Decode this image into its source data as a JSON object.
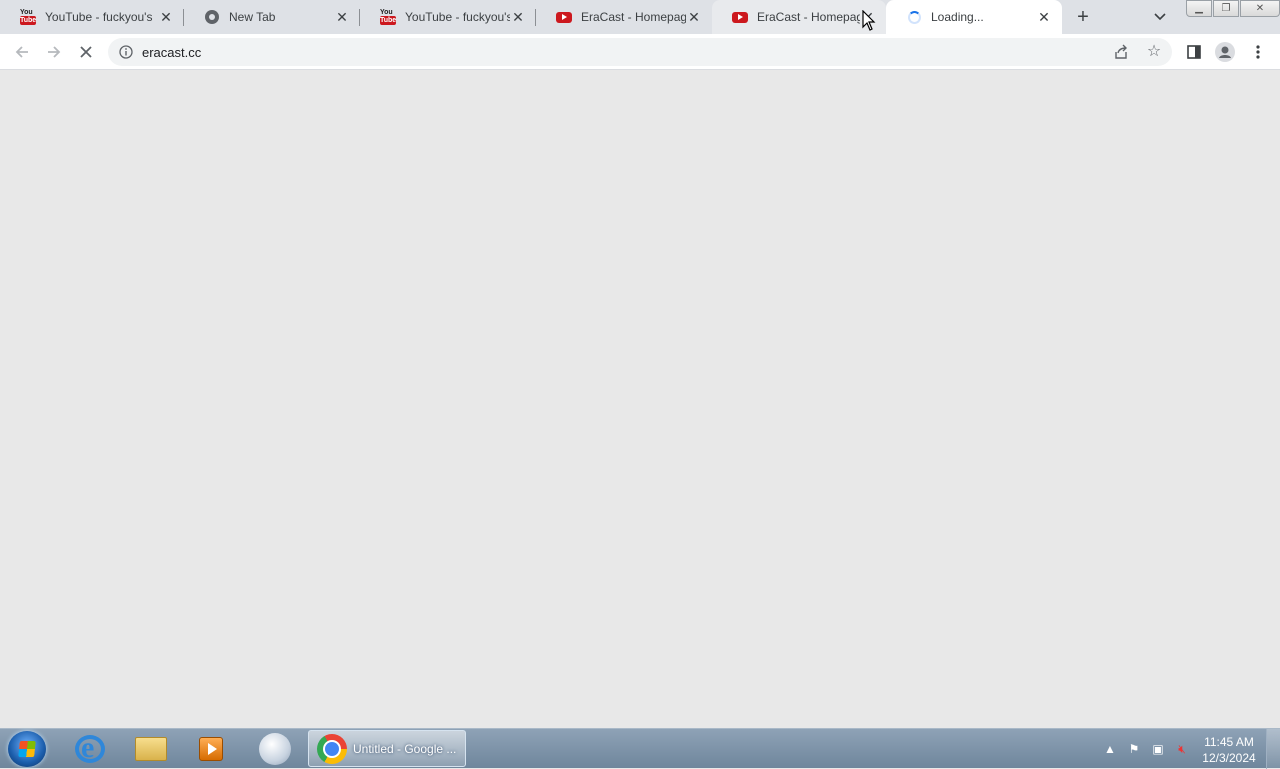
{
  "browser": {
    "tabs": [
      {
        "title": "YouTube - fuckyou's",
        "icon": "youtube-classic-icon"
      },
      {
        "title": "New Tab",
        "icon": "chrome-icon"
      },
      {
        "title": "YouTube - fuckyou's",
        "icon": "youtube-classic-icon"
      },
      {
        "title": "EraCast - Homepage",
        "icon": "youtube-icon"
      },
      {
        "title": "EraCast - Homepage",
        "icon": "youtube-icon"
      },
      {
        "title": "Loading...",
        "icon": "loading-spinner-icon"
      }
    ],
    "active_tab_index": 5,
    "address": "eracast.cc"
  },
  "taskbar": {
    "running_app_label": "Untitled - Google ...",
    "clock_time": "11:45 AM",
    "clock_date": "12/3/2024"
  },
  "colors": {
    "tab_strip": "#dee1e6",
    "content_bg": "#e8e8e8",
    "youtube_red": "#cc181e",
    "loading_blue": "#1a73e8"
  }
}
